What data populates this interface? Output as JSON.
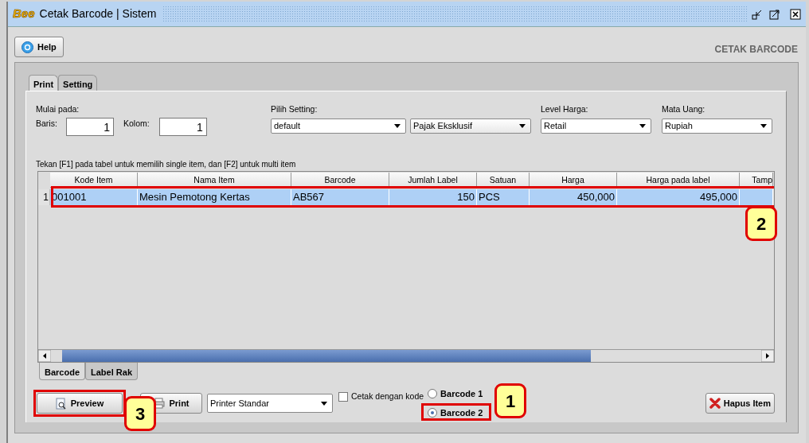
{
  "window": {
    "logo": "Bee",
    "title": "Cetak Barcode | Sistem"
  },
  "help_button": {
    "label": "Help"
  },
  "page_title": "CETAK BARCODE",
  "tabs": [
    {
      "label": "Print",
      "selected": true
    },
    {
      "label": "Setting",
      "selected": false
    }
  ],
  "start": {
    "label": "Mulai pada:",
    "row_label": "Baris:",
    "row_value": "1",
    "col_label": "Kolom:",
    "col_value": "1"
  },
  "selects": [
    {
      "label": "Pilih Setting:",
      "value": "default"
    },
    {
      "value": "Pajak Eksklusif"
    },
    {
      "label": "Level Harga:",
      "value": "Retail"
    },
    {
      "label": "Mata Uang:",
      "value": "Rupiah"
    }
  ],
  "hint": "Tekan [F1] pada tabel untuk memilih single item, dan [F2] untuk multi item",
  "table": {
    "columns": [
      "Kode Item",
      "Nama Item",
      "Barcode",
      "Jumlah Label",
      "Satuan",
      "Harga",
      "Harga pada label",
      "Tamp"
    ],
    "rows": [
      {
        "number": "1",
        "selected": true,
        "highlighted": true,
        "callout": "2",
        "cells": [
          "001001",
          "Mesin Pemotong Kertas",
          "AB567",
          "150",
          "PCS",
          "450,000",
          "495,000"
        ]
      }
    ]
  },
  "lower_tabs": [
    {
      "label": "Barcode",
      "selected": true
    },
    {
      "label": "Label Rak",
      "selected": false
    }
  ],
  "preview_button": {
    "label": "Preview",
    "highlighted": true,
    "callout": "3"
  },
  "print_button": {
    "label": "Print"
  },
  "printer_select": {
    "value": "Printer Standar"
  },
  "code_checkbox": {
    "label": "Cetak dengan kode",
    "checked": false
  },
  "barcode_options": [
    {
      "label": "Barcode 1",
      "selected": false
    },
    {
      "label": "Barcode 2",
      "selected": true,
      "highlighted": true,
      "callout": "1"
    }
  ],
  "delete_button": {
    "label": "Hapus Item"
  }
}
